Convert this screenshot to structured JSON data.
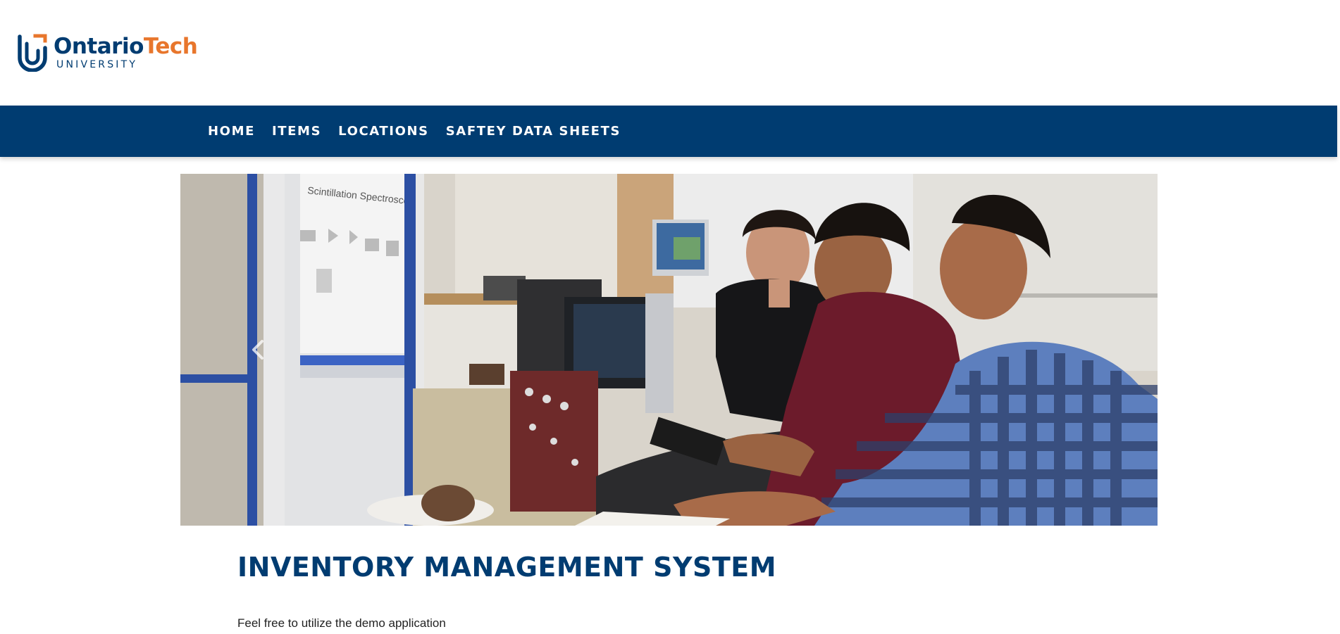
{
  "logo": {
    "name_part1": "Ontario",
    "name_part2": "Tech",
    "subtitle": "UNIVERSITY",
    "icon": "ontario-tech-shield-icon",
    "colors": {
      "primary": "#003c71",
      "accent": "#e8762c"
    }
  },
  "nav": {
    "items": [
      {
        "label": "HOME"
      },
      {
        "label": "ITEMS"
      },
      {
        "label": "LOCATIONS"
      },
      {
        "label": "SAFTEY DATA SHEETS"
      }
    ],
    "background": "#003c71"
  },
  "hero": {
    "image_text": "Scintillation Spectroscopy",
    "prev_icon": "chevron-left-icon"
  },
  "main": {
    "title": "INVENTORY MANAGEMENT SYSTEM",
    "text": "Feel free to utilize the demo application"
  }
}
